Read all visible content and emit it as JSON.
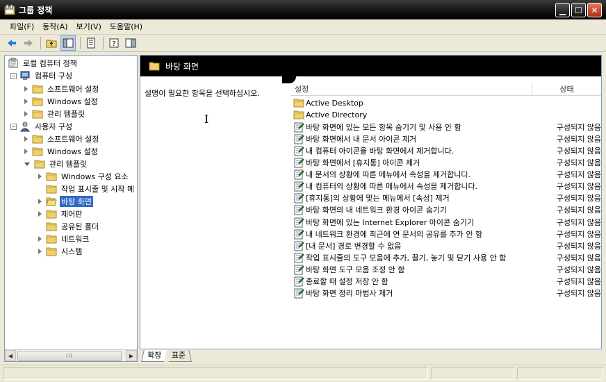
{
  "window": {
    "title": "그룹 정책"
  },
  "menu": [
    "파일(F)",
    "동작(A)",
    "보기(V)",
    "도움말(H)"
  ],
  "tree": [
    {
      "label": "로컬 컴퓨터 정책",
      "depth": 0,
      "exp": "none",
      "icon": "policy"
    },
    {
      "label": "컴퓨터 구성",
      "depth": 1,
      "exp": "minus",
      "icon": "computer"
    },
    {
      "label": "소프트웨어 설정",
      "depth": 2,
      "exp": "arrow",
      "icon": "folder"
    },
    {
      "label": "Windows 설정",
      "depth": 2,
      "exp": "arrow",
      "icon": "folder"
    },
    {
      "label": "관리 템플릿",
      "depth": 2,
      "exp": "arrow",
      "icon": "folder"
    },
    {
      "label": "사용자 구성",
      "depth": 1,
      "exp": "minus",
      "icon": "user"
    },
    {
      "label": "소프트웨어 설정",
      "depth": 2,
      "exp": "arrow",
      "icon": "folder"
    },
    {
      "label": "Windows 설정",
      "depth": 2,
      "exp": "arrow",
      "icon": "folder"
    },
    {
      "label": "관리 템플릿",
      "depth": 2,
      "exp": "open",
      "icon": "folder"
    },
    {
      "label": "Windows 구성 요소",
      "depth": 3,
      "exp": "arrow",
      "icon": "folder"
    },
    {
      "label": "작업 표시줄 및 시작 메",
      "depth": 3,
      "exp": "none",
      "icon": "folder"
    },
    {
      "label": "바탕 화면",
      "depth": 3,
      "exp": "arrow",
      "icon": "folder-open",
      "selected": true
    },
    {
      "label": "제어판",
      "depth": 3,
      "exp": "arrow",
      "icon": "folder"
    },
    {
      "label": "공유된 폴더",
      "depth": 3,
      "exp": "none",
      "icon": "folder"
    },
    {
      "label": "네트워크",
      "depth": 3,
      "exp": "arrow",
      "icon": "folder"
    },
    {
      "label": "시스템",
      "depth": 3,
      "exp": "arrow",
      "icon": "folder"
    }
  ],
  "right_pane": {
    "title": "바탕 화면",
    "description": "설명이 필요한 항목을 선택하십시오.",
    "columns": {
      "name": "설정",
      "state": "상태"
    },
    "rows": [
      {
        "name": "Active Desktop",
        "state": "",
        "type": "folder"
      },
      {
        "name": "Active Directory",
        "state": "",
        "type": "folder"
      },
      {
        "name": "바탕 화면에 있는 모든 항목 숨기기 및 사용 안 함",
        "state": "구성되지 않음",
        "type": "setting"
      },
      {
        "name": "바탕 화면에서 내 문서 아이콘 제거",
        "state": "구성되지 않음",
        "type": "setting"
      },
      {
        "name": "내 컴퓨터 아이콘을 바탕 화면에서 제거합니다.",
        "state": "구성되지 않음",
        "type": "setting"
      },
      {
        "name": "바탕 화면에서 [휴지통] 아이콘 제거",
        "state": "구성되지 않음",
        "type": "setting"
      },
      {
        "name": "내 문서의 상황에 따른 메뉴에서 속성을 제거합니다.",
        "state": "구성되지 않음",
        "type": "setting"
      },
      {
        "name": "내 컴퓨터의 상황에 따른 메뉴에서 속성을 제거합니다.",
        "state": "구성되지 않음",
        "type": "setting"
      },
      {
        "name": "[휴지통]의 상황에 맞는 메뉴에서 [속성] 제거",
        "state": "구성되지 않음",
        "type": "setting"
      },
      {
        "name": "바탕 화면의 내 네트워크 환경 아이콘 숨기기",
        "state": "구성되지 않음",
        "type": "setting"
      },
      {
        "name": "바탕 화면에 있는 Internet Explorer 아이콘 숨기기",
        "state": "구성되지 않음",
        "type": "setting"
      },
      {
        "name": "내 네트워크 환경에 최근에 연 문서의 공유를 추가 안 함",
        "state": "구성되지 않음",
        "type": "setting"
      },
      {
        "name": "[내 문서] 경로 변경할 수 없음",
        "state": "구성되지 않음",
        "type": "setting"
      },
      {
        "name": "작업 표시줄의 도구 모음에 추가, 끌기, 놓기 및 닫기 사용 안 함",
        "state": "구성되지 않음",
        "type": "setting"
      },
      {
        "name": "바탕 화면 도구 모음 조정 안 함",
        "state": "구성되지 않음",
        "type": "setting"
      },
      {
        "name": "종료할 때 설정 저장 안 함",
        "state": "구성되지 않음",
        "type": "setting"
      },
      {
        "name": "바탕 화면 정리 마법사 제거",
        "state": "구성되지 않음",
        "type": "setting"
      }
    ]
  },
  "tabs": [
    "확장",
    "표준"
  ],
  "scroll_thumb": "III"
}
